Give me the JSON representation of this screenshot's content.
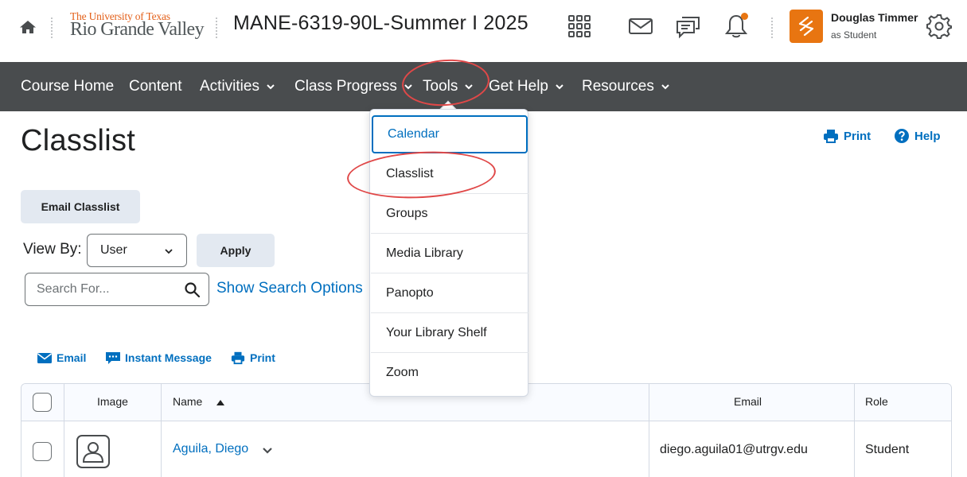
{
  "header": {
    "logo_line1": "The University of Texas",
    "logo_line2": "Rio Grande Valley",
    "course_title": "MANE-6319-90L-Summer I 2025",
    "icons": [
      "home-icon",
      "grid-icon",
      "mail-icon",
      "chat-icon",
      "bell-icon",
      "gear-icon"
    ],
    "user_name": "Douglas Timmer",
    "user_role": "as Student"
  },
  "nav": {
    "items": [
      "Course Home",
      "Content",
      "Activities",
      "Class Progress",
      "Tools",
      "Get Help",
      "Resources"
    ]
  },
  "tools_menu": {
    "items": [
      "Calendar",
      "Classlist",
      "Groups",
      "Media Library",
      "Panopto",
      "Your Library Shelf",
      "Zoom"
    ]
  },
  "page": {
    "title": "Classlist",
    "print_label": "Print",
    "help_label": "Help",
    "email_classlist_label": "Email Classlist",
    "view_by_label": "View By:",
    "view_by_value": "User",
    "apply_label": "Apply",
    "search_placeholder": "Search For...",
    "show_search_options": "Show Search Options",
    "actions": {
      "email": "Email",
      "instant_message": "Instant Message",
      "print": "Print"
    }
  },
  "table": {
    "columns": [
      "Image",
      "Name",
      "Email",
      "Role"
    ],
    "rows": [
      {
        "name": "Aguila, Diego",
        "email": "diego.aguila01@utrgv.edu",
        "role": "Student"
      }
    ]
  },
  "colors": {
    "accent": "#006fbf",
    "navbar": "#494c4e",
    "brand_orange": "#e87511",
    "annotation_red": "#e04848"
  }
}
